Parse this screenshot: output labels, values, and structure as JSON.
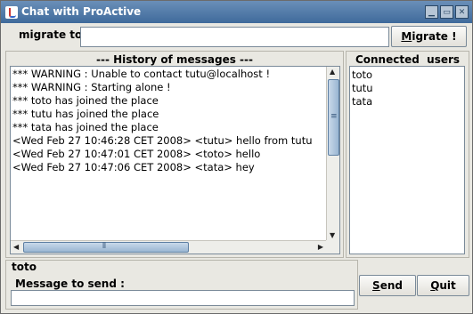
{
  "window": {
    "title": "Chat with ProActive",
    "icons": [
      "java-app-icon",
      "minimize-icon",
      "maximize-icon",
      "close-icon"
    ]
  },
  "migrate": {
    "label": "migrate to",
    "value": "",
    "button_label": "Migrate !"
  },
  "history": {
    "title": "--- History of messages ---",
    "messages": [
      "*** WARNING : Unable to contact tutu@localhost !",
      "*** WARNING : Starting alone !",
      "*** toto has joined the place",
      "*** tutu has joined the place",
      "*** tata has joined the place",
      "<Wed Feb 27 10:46:28 CET 2008> <tutu> hello from tutu",
      "<Wed Feb 27 10:47:01 CET 2008> <toto> hello",
      "<Wed Feb 27 10:47:06 CET 2008> <tata> hey"
    ]
  },
  "users": {
    "title": "Connected  users",
    "list": [
      "toto",
      "tutu",
      "tata"
    ]
  },
  "send": {
    "current_user": "toto",
    "label": "Message to send :",
    "value": "",
    "send_label": "Send",
    "quit_label": "Quit"
  }
}
